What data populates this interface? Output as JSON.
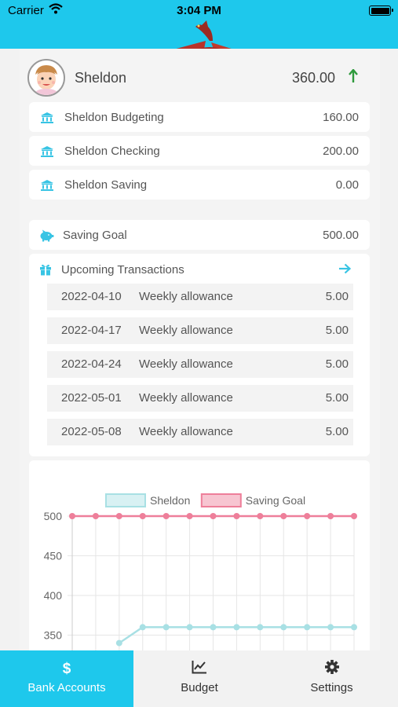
{
  "status_bar": {
    "carrier": "Carrier",
    "time": "3:04 PM"
  },
  "owner": {
    "name": "Sheldon",
    "total": "360.00",
    "trend_icon": "arrow-up-icon"
  },
  "accounts": [
    {
      "name": "Sheldon Budgeting",
      "value": "160.00",
      "icon": "bank-icon"
    },
    {
      "name": "Sheldon Checking",
      "value": "200.00",
      "icon": "bank-icon"
    },
    {
      "name": "Sheldon Saving",
      "value": "0.00",
      "icon": "bank-icon"
    }
  ],
  "saving_goal": {
    "label": "Saving Goal",
    "value": "500.00",
    "icon": "piggy-bank-icon"
  },
  "upcoming": {
    "title": "Upcoming Transactions",
    "icon": "gift-icon",
    "transactions": [
      {
        "date": "2022-04-10",
        "description": "Weekly allowance",
        "amount": "5.00"
      },
      {
        "date": "2022-04-17",
        "description": "Weekly allowance",
        "amount": "5.00"
      },
      {
        "date": "2022-04-24",
        "description": "Weekly allowance",
        "amount": "5.00"
      },
      {
        "date": "2022-05-01",
        "description": "Weekly allowance",
        "amount": "5.00"
      },
      {
        "date": "2022-05-08",
        "description": "Weekly allowance",
        "amount": "5.00"
      }
    ]
  },
  "chart_data": {
    "type": "line",
    "legend_position": "top",
    "grid": true,
    "yticks": [
      "500",
      "450",
      "400",
      "350"
    ],
    "ylim": [
      325,
      505
    ],
    "x": [
      1,
      2,
      3,
      4,
      5,
      6,
      7,
      8,
      9,
      10,
      11,
      12,
      13
    ],
    "series": [
      {
        "name": "Sheldon",
        "color": "#a8e0e4",
        "values": [
          null,
          null,
          340,
          360,
          360,
          360,
          360,
          360,
          360,
          360,
          360,
          360,
          360
        ]
      },
      {
        "name": "Saving Goal",
        "color": "#ee7f9a",
        "values": [
          500,
          500,
          500,
          500,
          500,
          500,
          500,
          500,
          500,
          500,
          500,
          500,
          500
        ]
      }
    ]
  },
  "tabs": [
    {
      "label": "Bank Accounts",
      "icon": "dollar-icon",
      "active": true
    },
    {
      "label": "Budget",
      "icon": "chart-line-icon",
      "active": false
    },
    {
      "label": "Settings",
      "icon": "gear-icon",
      "active": false
    }
  ],
  "colors": {
    "accent": "#1ec8ec",
    "up_green": "#2e9a3c"
  }
}
